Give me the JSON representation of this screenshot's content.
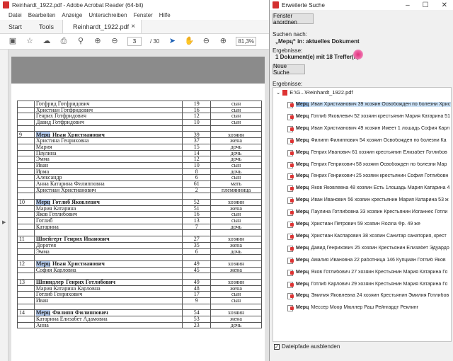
{
  "acrobat": {
    "title": "Reinhardt_1922.pdf - Adobe Acrobat Reader (64-bit)",
    "menu": [
      "Datei",
      "Bearbeiten",
      "Anzeige",
      "Unterschreiben",
      "Fenster",
      "Hilfe"
    ],
    "tabs": [
      "Start",
      "Tools"
    ],
    "doc_tab": "Reinhardt_1922.pdf",
    "page_current": "3",
    "page_total": "/ 30",
    "zoom": "81,3%"
  },
  "census_rows": [
    {
      "num": "",
      "name": "Готфрид Готфридович",
      "age": "19",
      "rel": "сын"
    },
    {
      "num": "",
      "name": "Христиан Готфридович",
      "age": "16",
      "rel": "сын"
    },
    {
      "num": "",
      "name": "Генрих Готфридович",
      "age": "12",
      "rel": "сын"
    },
    {
      "num": "",
      "name": "Давид Готфридович",
      "age": "10",
      "rel": "сын"
    },
    {
      "num": "",
      "name": "",
      "age": "",
      "rel": ""
    },
    {
      "num": "9",
      "pre": "",
      "hl": "Мерц",
      "name": "Иван Христианович",
      "age": "39",
      "rel": "хозяин",
      "bold": true
    },
    {
      "num": "",
      "name": "Христина Генриховна",
      "age": "37",
      "rel": "жена"
    },
    {
      "num": "",
      "name": "Мария",
      "age": "15",
      "rel": "дочь"
    },
    {
      "num": "",
      "name": "Паулина",
      "age": "14",
      "rel": "дочь"
    },
    {
      "num": "",
      "name": "Эмма",
      "age": "12",
      "rel": "дочь"
    },
    {
      "num": "",
      "name": "Иван",
      "age": "10",
      "rel": "сын"
    },
    {
      "num": "",
      "name": "Ирма",
      "age": "8",
      "rel": "дочь"
    },
    {
      "num": "",
      "name": "Александр",
      "age": "6",
      "rel": "сын"
    },
    {
      "num": "",
      "name": "Анна Катарина Филипповна",
      "age": "61",
      "rel": "мать"
    },
    {
      "num": "",
      "name": "Христиан Христианович",
      "age": "2",
      "rel": "племянница"
    },
    {
      "num": "",
      "name": "",
      "age": "",
      "rel": ""
    },
    {
      "num": "10",
      "hl": "Мерц",
      "name": "Готлиб Яковлевич",
      "age": "52",
      "rel": "хозяин",
      "bold": true
    },
    {
      "num": "",
      "name": "Мария Катарина",
      "age": "51",
      "rel": "жена"
    },
    {
      "num": "",
      "name": "Яков Готлибович",
      "age": "16",
      "rel": "сын"
    },
    {
      "num": "",
      "name": "Готлиб",
      "age": "13",
      "rel": "сын"
    },
    {
      "num": "",
      "name": "Катарина",
      "age": "7",
      "rel": "дочь"
    },
    {
      "num": "",
      "name": "",
      "age": "",
      "rel": ""
    },
    {
      "num": "11",
      "hl": "Швейгерт",
      "name": "Генрих Иванович",
      "age": "27",
      "rel": "хозяин",
      "bold": true,
      "plain": true
    },
    {
      "num": "",
      "name": "Доротея",
      "age": "35",
      "rel": "жена"
    },
    {
      "num": "",
      "name": "Эмма",
      "age": "6",
      "rel": "дочь"
    },
    {
      "num": "",
      "name": "",
      "age": "",
      "rel": ""
    },
    {
      "num": "12",
      "hl": "Мерц",
      "name": "Иван Христианович",
      "age": "49",
      "rel": "хозяин",
      "bold": true
    },
    {
      "num": "",
      "name": "София Карловна",
      "age": "45",
      "rel": "жена"
    },
    {
      "num": "",
      "name": "",
      "age": "",
      "rel": ""
    },
    {
      "num": "13",
      "hl": "Шпиндлер",
      "name": "Генрих Готлибович",
      "age": "49",
      "rel": "хозяин",
      "bold": true,
      "plain": true
    },
    {
      "num": "",
      "name": "Мария Катарина Карловна",
      "age": "48",
      "rel": "жена"
    },
    {
      "num": "",
      "name": "Готлиб Генрихович",
      "age": "17",
      "rel": "сын"
    },
    {
      "num": "",
      "name": "Иван",
      "age": "9",
      "rel": "сын"
    },
    {
      "num": "",
      "name": "",
      "age": "",
      "rel": ""
    },
    {
      "num": "14",
      "hl": "Мерц",
      "name": "Филипп Филиппович",
      "age": "54",
      "rel": "хозяин",
      "bold": true
    },
    {
      "num": "",
      "name": "Катарина Елизабет Адамовна",
      "age": "53",
      "rel": "жена"
    },
    {
      "num": "",
      "name": "Анна",
      "age": "23",
      "rel": "дочь"
    }
  ],
  "search": {
    "window_title": "Erweiterte Suche",
    "arrange_button": "Fenster anordnen",
    "searched_for_label": "Suchen nach:",
    "searched_for_value": "„Мерц“ in: aktuelles Dokument",
    "results_label": "Ergebnisse:",
    "results_summary": "1 Dokument(e) mit 18 Treffer(n)",
    "new_search_button": "Neue Suche",
    "results_list_label": "Ergebnisse:",
    "root": "E:\\G...\\Reinhardt_1922.pdf",
    "hide_paths_label": "Dateipfade ausblenden",
    "hide_paths_checked": "✓",
    "items": [
      "Иван Христианович 39 хозяин Освобожден по болезни Христ",
      "Готлиб Яковлевич 52 хозяин крестьянин Мария Катарина 51",
      "Иван Христианович 49 хозяин Имеет 1 лошадь София Карл",
      "Филипп Филиппович 54 хозяин Освобожден по болезни Ка",
      "Генрих Иванович 61 хозяин крестьянин Елизабет Готлибов",
      "Генрих Генрихович 58 хозяин Освобожден по болезни Мар",
      "Генрих Генрихович 25 хозяин крестьянин София Готлибовн",
      "Яков Яковлевна 48 хозяин Есть 1лошадь Мария Катарина 4",
      "Иван Иванович 56 хозяин крестьянин Мария Катарина 53 ж",
      "Паулина Готлибовна 33 хозяин Крестьянин Иоганнес Готли",
      "Христиан Петрович 59 хозяин Rozina Фр. 49 же",
      "Христиан Каспарович 38 хозяин Санитар санатория, крест",
      "Давид Генрихович 25 хозяин Крестьянин Елизабет Эдуардо",
      "Амалия Ивановна 22 работница 146 Купцман Готлиб Яков",
      "Яков Готлибович 27 хозяин Крестьянин Мария Катарина Го",
      "Готлиб Карлович 29 хозяин Крестьянин Мария Катарина Го",
      "Эмилия Яковлевна 24 хозяин Крестьянин Эмилия Готлибов",
      "Мессер Моор Мюллер Раш Рейнгардт Реклинг"
    ],
    "item_word": "Мерц"
  }
}
